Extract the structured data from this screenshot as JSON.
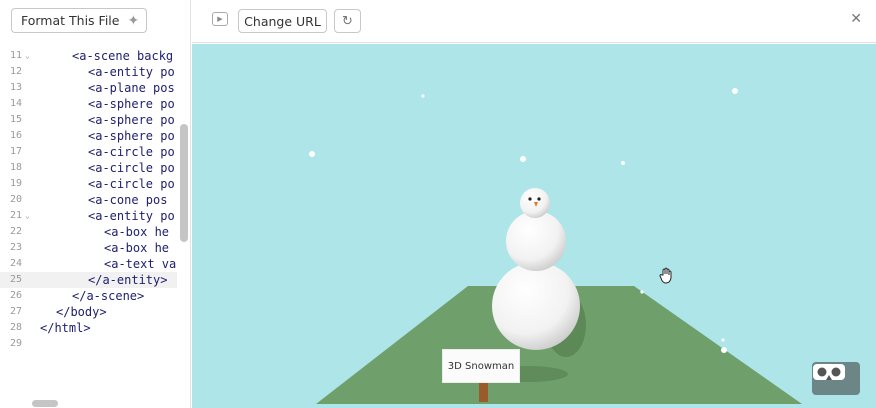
{
  "editor": {
    "format_button": "Format This File",
    "lines": [
      {
        "num": "11",
        "fold": true,
        "indent": 2,
        "text": "<a-scene backg"
      },
      {
        "num": "12",
        "fold": false,
        "indent": 3,
        "text": "<a-entity po"
      },
      {
        "num": "13",
        "fold": false,
        "indent": 3,
        "text": "<a-plane pos"
      },
      {
        "num": "14",
        "fold": false,
        "indent": 3,
        "text": "<a-sphere po"
      },
      {
        "num": "15",
        "fold": false,
        "indent": 3,
        "text": "<a-sphere po"
      },
      {
        "num": "16",
        "fold": false,
        "indent": 3,
        "text": "<a-sphere po"
      },
      {
        "num": "17",
        "fold": false,
        "indent": 3,
        "text": "<a-circle po"
      },
      {
        "num": "18",
        "fold": false,
        "indent": 3,
        "text": "<a-circle po"
      },
      {
        "num": "19",
        "fold": false,
        "indent": 3,
        "text": "<a-circle po"
      },
      {
        "num": "20",
        "fold": false,
        "indent": 3,
        "text": "<a-cone pos"
      },
      {
        "num": "21",
        "fold": true,
        "indent": 3,
        "text": "<a-entity po"
      },
      {
        "num": "22",
        "fold": false,
        "indent": 4,
        "text": "<a-box he"
      },
      {
        "num": "23",
        "fold": false,
        "indent": 4,
        "text": "<a-box he"
      },
      {
        "num": "24",
        "fold": false,
        "indent": 4,
        "text": "<a-text va"
      },
      {
        "num": "25",
        "fold": false,
        "indent": 3,
        "text": "</a-entity>",
        "active": true
      },
      {
        "num": "26",
        "fold": false,
        "indent": 2,
        "text": "</a-scene>"
      },
      {
        "num": "27",
        "fold": false,
        "indent": 1,
        "text": "</body>"
      },
      {
        "num": "28",
        "fold": false,
        "indent": 0,
        "text": "</html>"
      },
      {
        "num": "29",
        "fold": false,
        "indent": 0,
        "text": ""
      }
    ]
  },
  "toolbar": {
    "change_url_label": "Change URL",
    "refresh_icon": "refresh-icon",
    "play_icon": "play-icon",
    "close_icon": "close-icon"
  },
  "scene": {
    "sign_text": "3D Snowman",
    "sky_color": "#ade5e8",
    "ground_color": "#6f9f6b",
    "vr_icon": "vr-headset-icon"
  }
}
